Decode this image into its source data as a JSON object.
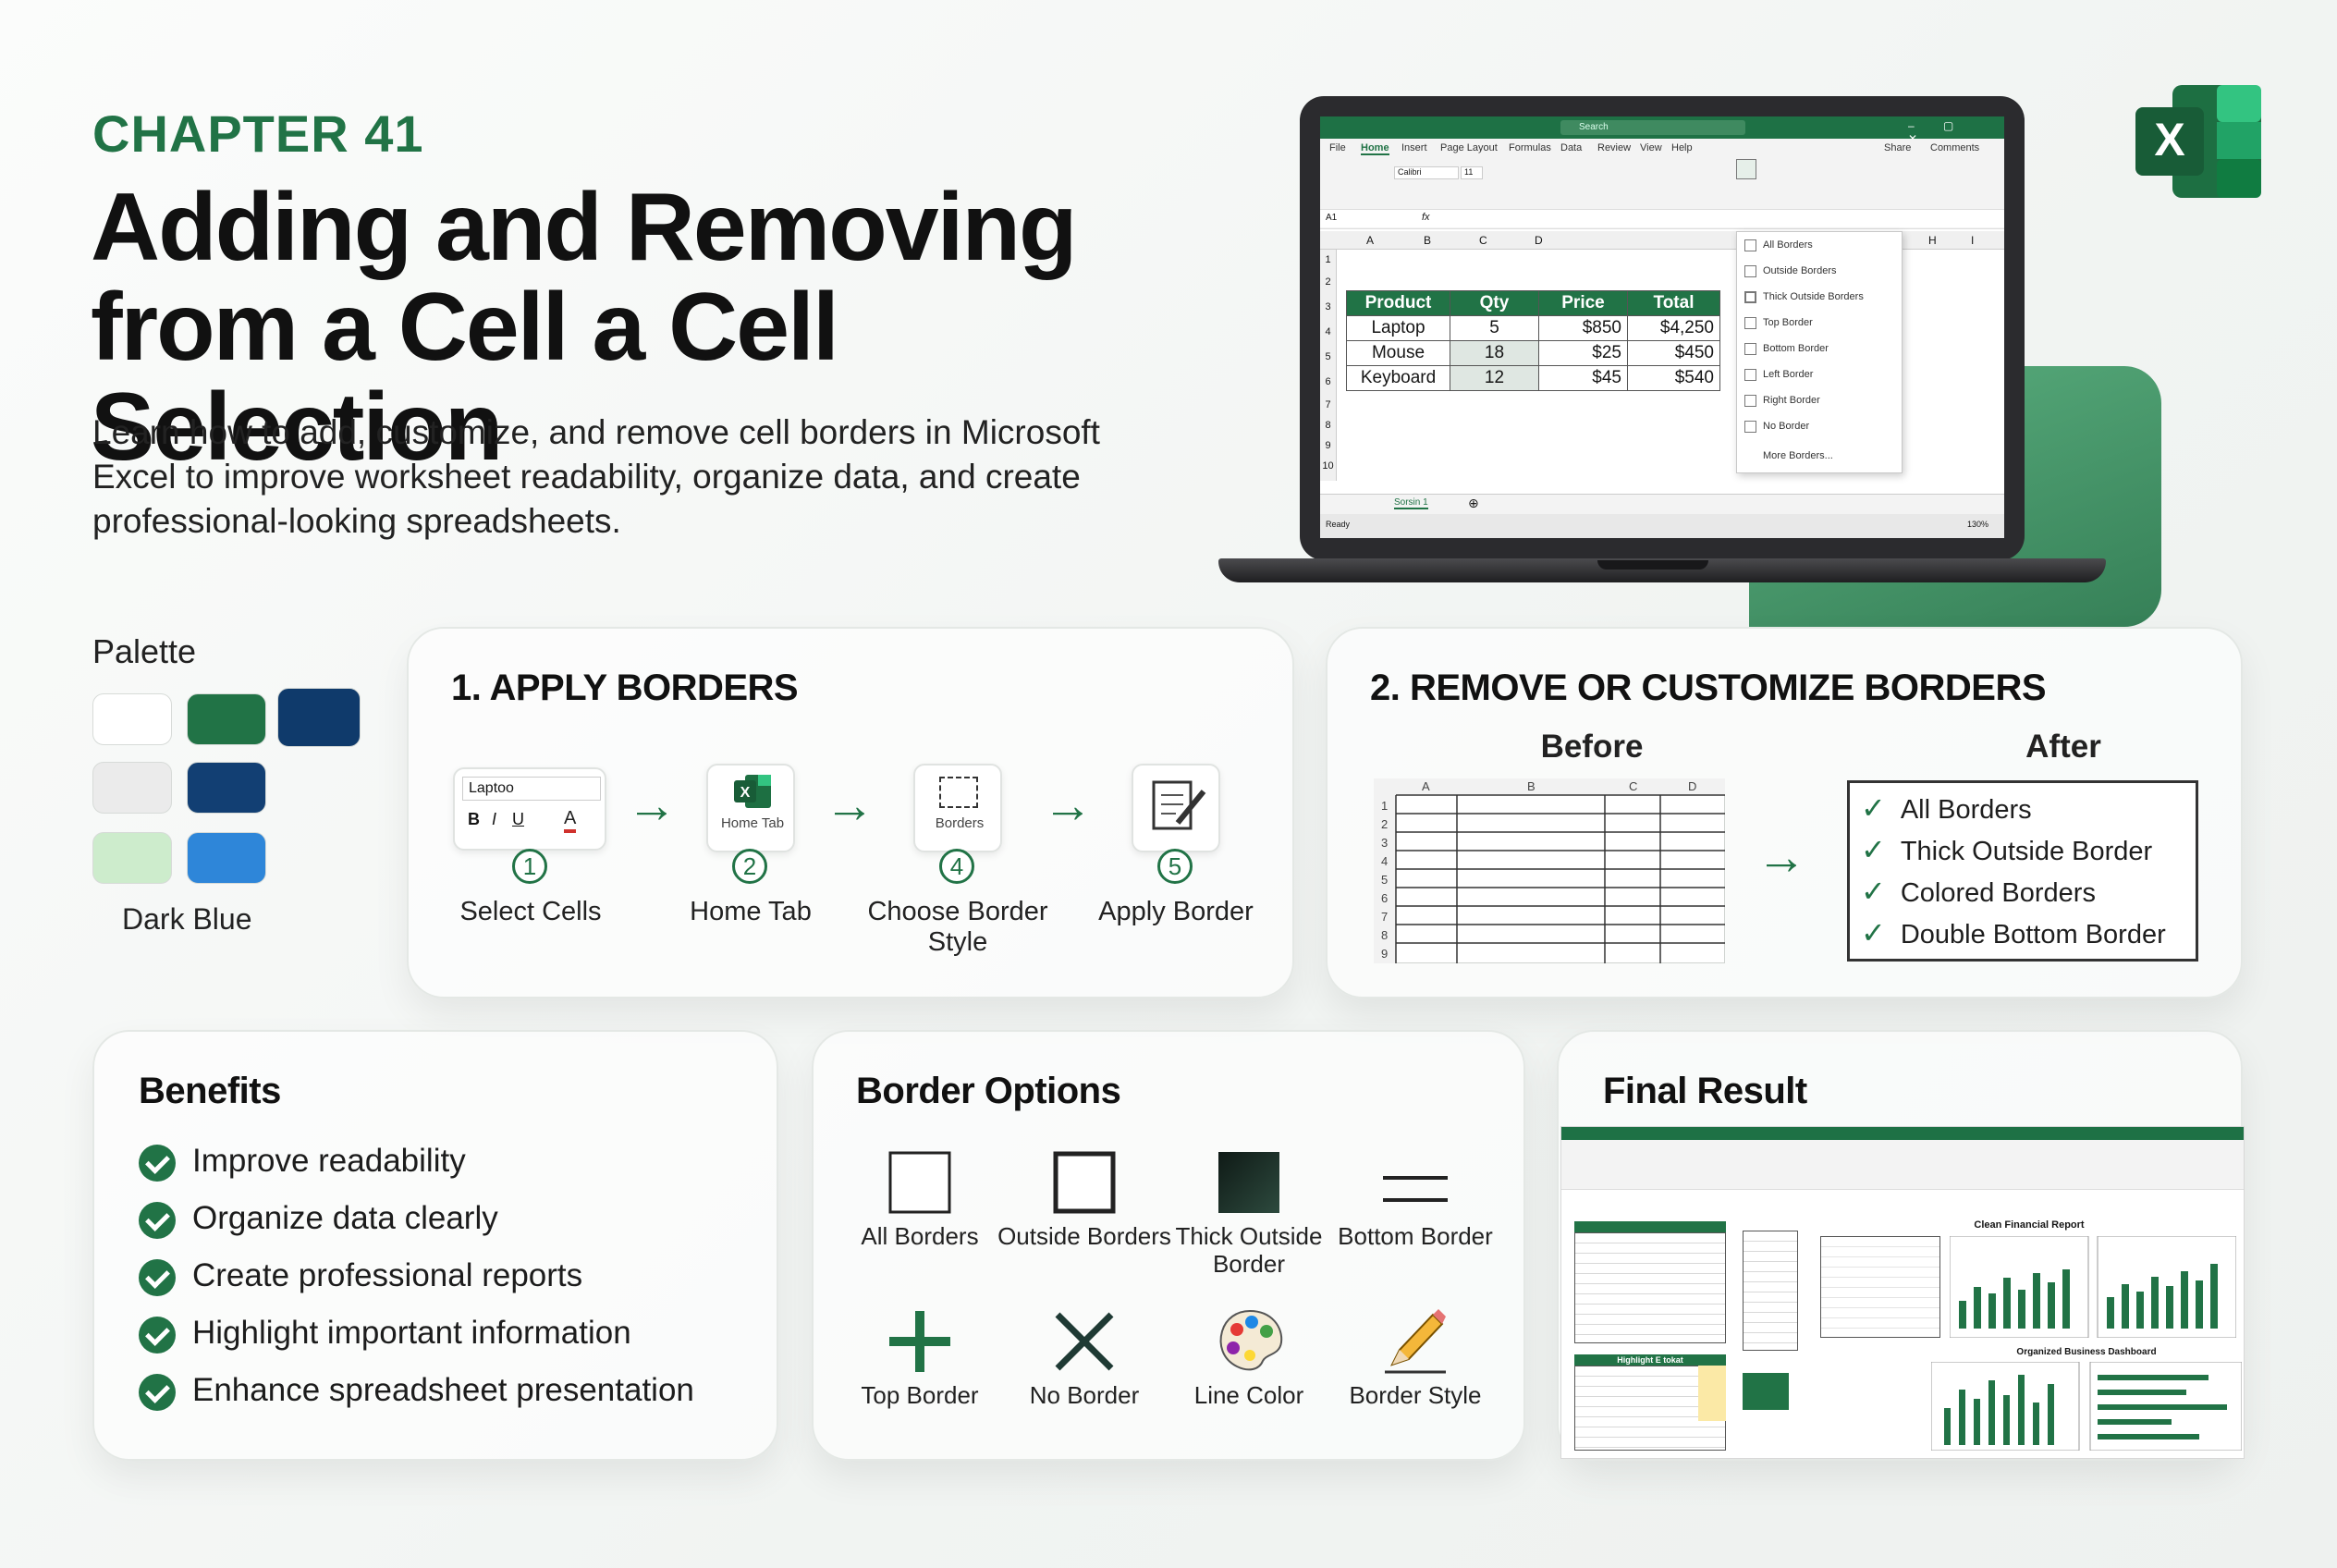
{
  "header": {
    "chapter": "CHAPTER 41",
    "title_line1": "Adding and Removing",
    "title_line2": "from a Cell a Cell Selection",
    "subtitle": "Learn how to add, customize, and remove cell borders in Microsoft Excel to improve worksheet readability, organize data, and create professional-looking spreadsheets."
  },
  "palette": {
    "label": "Palette",
    "caption": "Dark Blue",
    "colors": [
      "#ffffff",
      "#217346",
      "#0f3a6b",
      "#ebebeb",
      "#123f73",
      "#cdeccc",
      "#2e86d9"
    ]
  },
  "apply": {
    "title": "1. APPLY BORDERS",
    "steps": [
      {
        "num": "1",
        "label": "Select Cells",
        "mock_text": "Laptoo"
      },
      {
        "num": "2",
        "label": "Home Tab",
        "mock_text": "Home Tab"
      },
      {
        "num": "4",
        "label": "Choose Border Style",
        "mock_text": "Borders"
      },
      {
        "num": "5",
        "label": "Apply Border"
      }
    ]
  },
  "remove": {
    "title": "2. REMOVE OR CUSTOMIZE BORDERS",
    "before": "Before",
    "after": "After",
    "grid_cols": [
      "A",
      "B",
      "C",
      "D"
    ],
    "grid_rows": [
      "1",
      "2",
      "3",
      "4",
      "5",
      "6",
      "7",
      "8",
      "9"
    ],
    "after_items": [
      "All Borders",
      "Thick Outside Border",
      "Colored Borders",
      "Double Bottom Border"
    ]
  },
  "benefits": {
    "title": "Benefits",
    "items": [
      "Improve readability",
      "Organize data clearly",
      "Create professional reports",
      "Highlight important information",
      "Enhance spreadsheet presentation"
    ]
  },
  "options": {
    "title": "Border Options",
    "items": [
      "All Borders",
      "Outside Borders",
      "Thick Outside Border",
      "Bottom Border",
      "Top Border",
      "No Border",
      "Line Color",
      "Border Style"
    ]
  },
  "final": {
    "title": "Final Result",
    "report_title": "Clean Financial Report",
    "dashboard_title": "Organized Business Dashboard",
    "section_title": "Highlight E tokat"
  },
  "laptop": {
    "tabs": [
      "File",
      "Home",
      "Insert",
      "Page Layout",
      "Formulas",
      "Data",
      "Review",
      "View",
      "Help"
    ],
    "share": "Share",
    "comments": "Comments",
    "search": "Search",
    "name_box": "A1",
    "font": "Calibri",
    "font_size": "11",
    "columns": [
      "A",
      "B",
      "C",
      "D",
      "H",
      "I"
    ],
    "rows": [
      "1",
      "2",
      "3",
      "4",
      "5",
      "6",
      "7",
      "8",
      "9",
      "10"
    ],
    "table_header": [
      "Product",
      "Qty",
      "Price",
      "Total"
    ],
    "table_rows": [
      [
        "Laptop",
        "5",
        "$850",
        "$4,250"
      ],
      [
        "Mouse",
        "18",
        "$25",
        "$450"
      ],
      [
        "Keyboard",
        "12",
        "$45",
        "$540"
      ]
    ],
    "menu_items": [
      "All Borders",
      "Outside Borders",
      "Thick Outside Borders",
      "Top Border",
      "Bottom Border",
      "Left Border",
      "Right Border",
      "No Border",
      "More Borders..."
    ],
    "sheet_tab": "Sorsin 1",
    "status": "Ready",
    "zoom": "130%"
  }
}
